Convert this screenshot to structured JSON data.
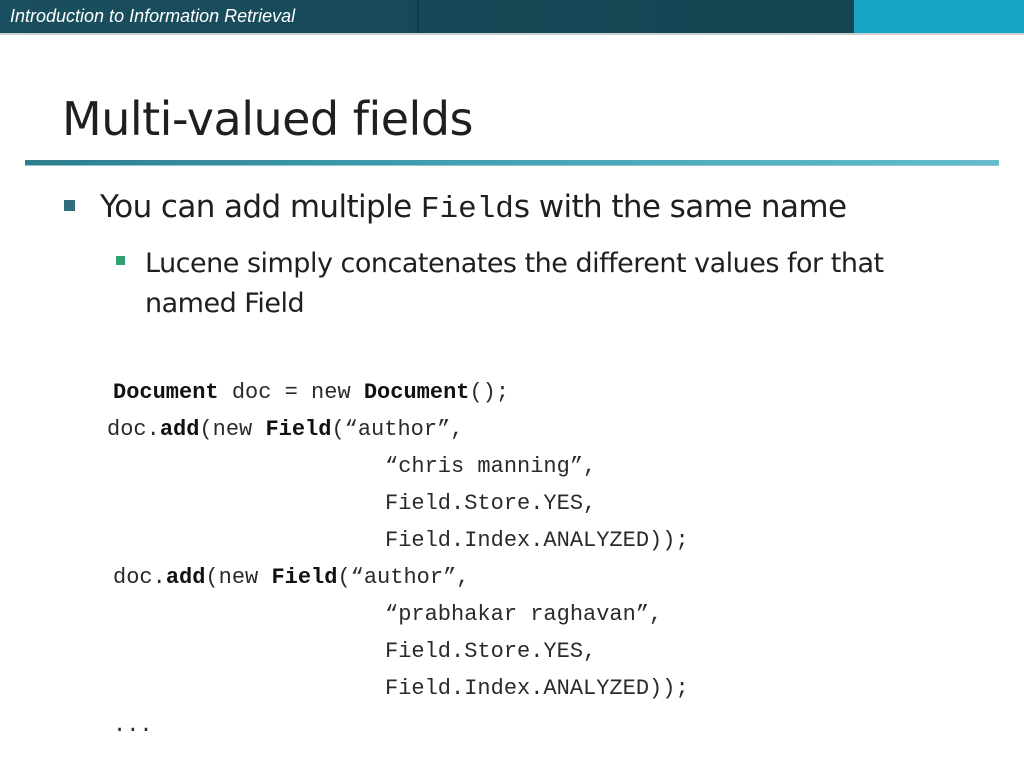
{
  "header": {
    "course_title": "Introduction to Information Retrieval"
  },
  "slide": {
    "title": "Multi-valued fields",
    "bullet1": {
      "prefix": "You can add multiple ",
      "code_word": "Field",
      "suffix": "s with the same name"
    },
    "bullet2": {
      "text": "Lucene simply concatenates the different values for that named Field"
    }
  },
  "code": {
    "line1": {
      "kw1": "Document",
      "mid": " doc = new ",
      "kw2": "Document",
      "end": "();"
    },
    "line2": {
      "pre": "doc.",
      "kw1": "add",
      "mid": "(new ",
      "kw2": "Field",
      "end": "(“author”,"
    },
    "line3": "“chris manning”,",
    "line4": "Field.Store.YES,",
    "line5": "Field.Index.ANALYZED));",
    "line6": {
      "pre": "doc.",
      "kw1": "add",
      "mid": "(new ",
      "kw2": "Field",
      "end": "(“author”,"
    },
    "line7": "“prabhakar raghavan”,",
    "line8": "Field.Store.YES,",
    "line9": "Field.Index.ANALYZED));",
    "line10": "..."
  },
  "colors": {
    "header_dark": "#174a58",
    "header_light": "#17a4c4",
    "rule": "#3f9db0",
    "bullet1": "#2f6e7f",
    "bullet2": "#2fa070"
  }
}
